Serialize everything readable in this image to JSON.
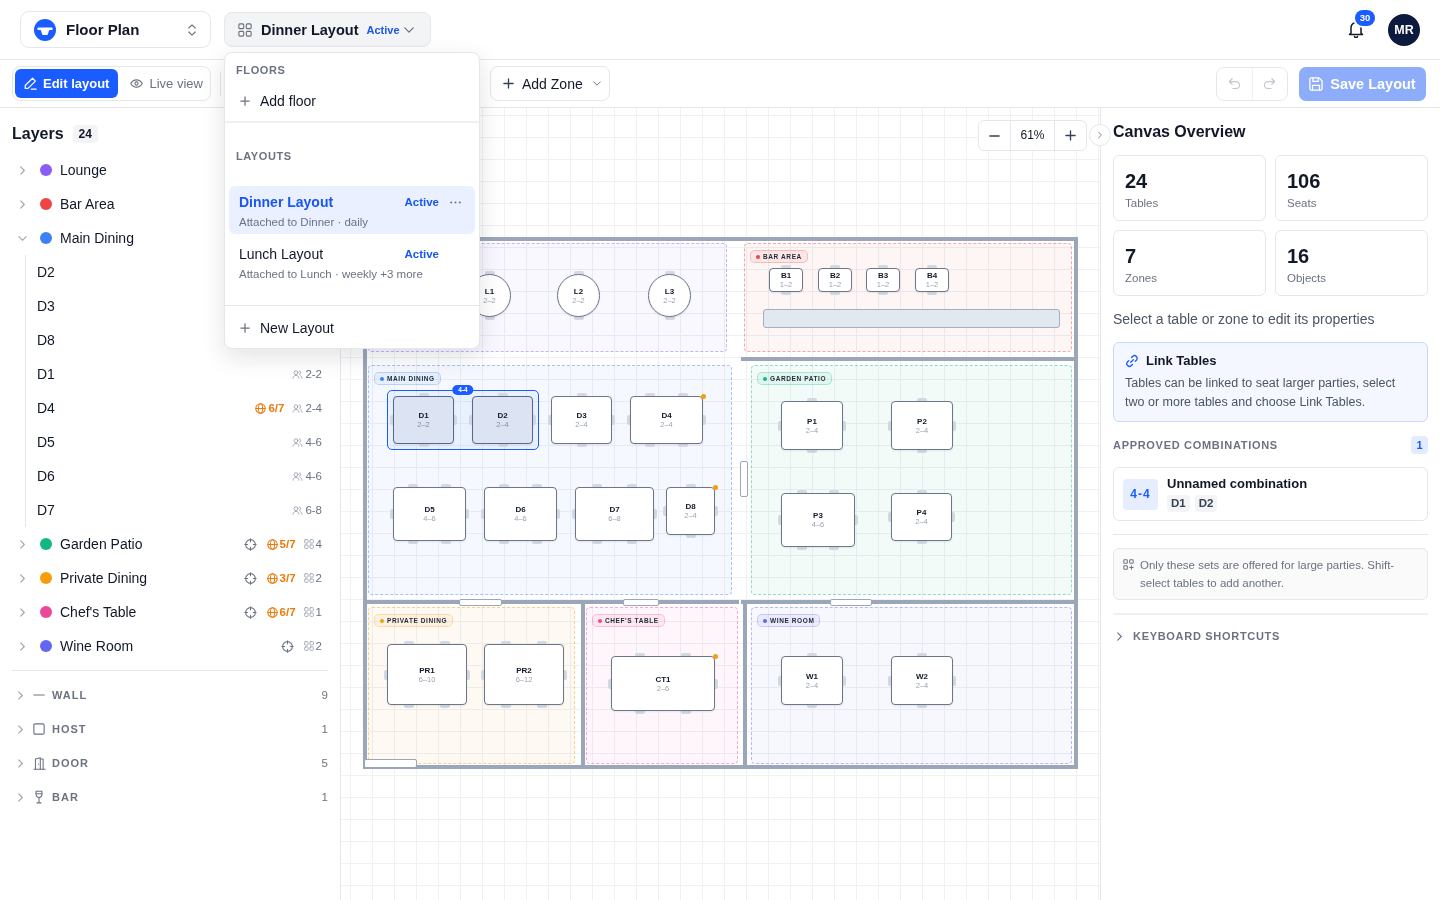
{
  "header": {
    "floor_selector": {
      "label": "Floor Plan"
    },
    "layout_switcher": {
      "name": "Dinner Layout",
      "status": "Active"
    },
    "notifications": {
      "count": "30"
    },
    "avatar": {
      "initials": "MR"
    }
  },
  "toolbar": {
    "modes": [
      {
        "kind": "edit",
        "label": "Edit layout",
        "selected": true
      },
      {
        "kind": "view",
        "label": "Live view",
        "selected": false
      }
    ],
    "add_zone": {
      "label": "Add Zone"
    },
    "undo": {
      "disabled": true
    },
    "redo": {
      "disabled": true
    },
    "save": {
      "label": "Save Layout",
      "disabled": true
    }
  },
  "layout_menu": {
    "floors_heading": "FLOORS",
    "add_floor": "Add floor",
    "layouts_heading": "LAYOUTS",
    "layouts": [
      {
        "name": "Dinner Layout",
        "status": "Active",
        "detail": "Attached to Dinner · daily",
        "selected": true
      },
      {
        "name": "Lunch Layout",
        "status": "Active",
        "detail": "Attached to Lunch · weekly +3 more",
        "selected": false
      }
    ],
    "new_layout": "New Layout"
  },
  "layers": {
    "title": "Layers",
    "count": "24",
    "zones": [
      {
        "name": "Lounge",
        "color": "#8b5cf6",
        "expanded": false
      },
      {
        "name": "Bar Area",
        "color": "#ef4444",
        "expanded": false
      },
      {
        "name": "Main Dining",
        "color": "#3b82f6",
        "expanded": true,
        "children": [
          {
            "name": "D2"
          },
          {
            "name": "D3"
          },
          {
            "name": "D8"
          },
          {
            "name": "D1",
            "badges": [
              {
                "kind": "seats",
                "text": "2-2"
              }
            ]
          },
          {
            "name": "D4",
            "badges": [
              {
                "kind": "online",
                "text": "6/7"
              },
              {
                "kind": "seats",
                "text": "2-4"
              }
            ]
          },
          {
            "name": "D5",
            "badges": [
              {
                "kind": "seats",
                "text": "4-6"
              }
            ]
          },
          {
            "name": "D6",
            "badges": [
              {
                "kind": "seats",
                "text": "4-6"
              }
            ]
          },
          {
            "name": "D7",
            "badges": [
              {
                "kind": "seats",
                "text": "6-8"
              }
            ]
          }
        ]
      },
      {
        "name": "Garden Patio",
        "color": "#10b981",
        "expanded": false,
        "badges": [
          {
            "kind": "target"
          },
          {
            "kind": "online",
            "text": "5/7"
          },
          {
            "kind": "tables",
            "text": "4"
          }
        ]
      },
      {
        "name": "Private Dining",
        "color": "#f59e0b",
        "expanded": false,
        "badges": [
          {
            "kind": "target"
          },
          {
            "kind": "online",
            "text": "3/7"
          },
          {
            "kind": "tables",
            "text": "2"
          }
        ]
      },
      {
        "name": "Chef's Table",
        "color": "#ec4899",
        "expanded": false,
        "badges": [
          {
            "kind": "target"
          },
          {
            "kind": "online",
            "text": "6/7"
          },
          {
            "kind": "tables",
            "text": "1"
          }
        ]
      },
      {
        "name": "Wine Room",
        "color": "#6366f1",
        "expanded": false,
        "badges": [
          {
            "kind": "target"
          },
          {
            "kind": "tables",
            "text": "2"
          }
        ]
      }
    ],
    "objects": [
      {
        "kind": "wall",
        "name": "WALL",
        "count": "9"
      },
      {
        "kind": "host",
        "name": "HOST",
        "count": "1"
      },
      {
        "kind": "door",
        "name": "DOOR",
        "count": "5"
      },
      {
        "kind": "bar",
        "name": "BAR",
        "count": "1"
      }
    ]
  },
  "canvas": {
    "zoom": "61%",
    "zones": [
      {
        "tables": [
          {
            "label": "L1",
            "seats": "2–2",
            "kind": "round",
            "linked": false,
            "alert": false
          },
          {
            "label": "L2",
            "seats": "2–2",
            "kind": "round",
            "linked": false,
            "alert": false
          },
          {
            "label": "L3",
            "seats": "2–2",
            "kind": "round",
            "linked": false,
            "alert": false
          }
        ]
      },
      {
        "label": "BAR AREA",
        "tables": [
          {
            "label": "B1",
            "seats": "1–2",
            "kind": "rect",
            "linked": false,
            "alert": false
          },
          {
            "label": "B2",
            "seats": "1–2",
            "kind": "rect",
            "linked": false,
            "alert": false
          },
          {
            "label": "B3",
            "seats": "1–2",
            "kind": "rect",
            "linked": false,
            "alert": false
          },
          {
            "label": "B4",
            "seats": "1–2",
            "kind": "rect",
            "linked": false,
            "alert": false
          }
        ]
      },
      {
        "label": "MAIN DINING",
        "link_label": "4-4",
        "tables": [
          {
            "label": "D1",
            "seats": "2–2",
            "kind": "rect",
            "linked": true,
            "alert": false
          },
          {
            "label": "D2",
            "seats": "2–4",
            "kind": "rect",
            "linked": true,
            "alert": false
          },
          {
            "label": "D3",
            "seats": "2–4",
            "kind": "rect",
            "linked": false,
            "alert": false
          },
          {
            "label": "D4",
            "seats": "2–4",
            "kind": "rect",
            "linked": false,
            "alert": true
          },
          {
            "label": "D5",
            "seats": "4–6",
            "kind": "rect",
            "linked": false,
            "alert": false
          },
          {
            "label": "D6",
            "seats": "4–6",
            "kind": "rect",
            "linked": false,
            "alert": false
          },
          {
            "label": "D7",
            "seats": "6–8",
            "kind": "rect",
            "linked": false,
            "alert": false
          },
          {
            "label": "D8",
            "seats": "2–4",
            "kind": "rect",
            "linked": false,
            "alert": true
          }
        ]
      },
      {
        "label": "GARDEN PATIO",
        "tables": [
          {
            "label": "P1",
            "seats": "2–4",
            "kind": "rect",
            "linked": false,
            "alert": false
          },
          {
            "label": "P2",
            "seats": "2–4",
            "kind": "rect",
            "linked": false,
            "alert": false
          },
          {
            "label": "P3",
            "seats": "4–6",
            "kind": "rect",
            "linked": false,
            "alert": false
          },
          {
            "label": "P4",
            "seats": "2–4",
            "kind": "rect",
            "linked": false,
            "alert": false
          }
        ]
      },
      {
        "label": "PRIVATE DINING",
        "tables": [
          {
            "label": "PR1",
            "seats": "6–10",
            "kind": "rect",
            "linked": false,
            "alert": false
          },
          {
            "label": "PR2",
            "seats": "6–12",
            "kind": "rect",
            "linked": false,
            "alert": false
          }
        ]
      },
      {
        "label": "CHEF'S TABLE",
        "tables": [
          {
            "label": "CT1",
            "seats": "2–6",
            "kind": "rect",
            "linked": false,
            "alert": true
          }
        ]
      },
      {
        "label": "WINE ROOM",
        "tables": [
          {
            "label": "W1",
            "seats": "2–4",
            "kind": "rect",
            "linked": false,
            "alert": false
          },
          {
            "label": "W2",
            "seats": "2–4",
            "kind": "rect",
            "linked": false,
            "alert": false
          }
        ]
      }
    ]
  },
  "overview": {
    "title": "Canvas Overview",
    "stats": [
      {
        "value": "24",
        "label": "Tables"
      },
      {
        "value": "106",
        "label": "Seats"
      },
      {
        "value": "7",
        "label": "Zones"
      },
      {
        "value": "16",
        "label": "Objects"
      }
    ],
    "hint": "Select a table or zone to edit its properties",
    "link_tables": {
      "title": "Link Tables",
      "text": "Tables can be linked to seat larger parties, select two or more tables and choose Link Tables."
    },
    "combinations": {
      "heading": "APPROVED COMBINATIONS",
      "count": "1",
      "items": [
        {
          "range": "4-4",
          "name": "Unnamed combination",
          "tables": [
            "D1",
            "D2"
          ]
        }
      ]
    },
    "note": "Only these sets are offered for large parties. Shift-select tables to add another.",
    "shortcuts": {
      "label": "KEYBOARD SHORTCUTS",
      "expanded": false
    }
  }
}
